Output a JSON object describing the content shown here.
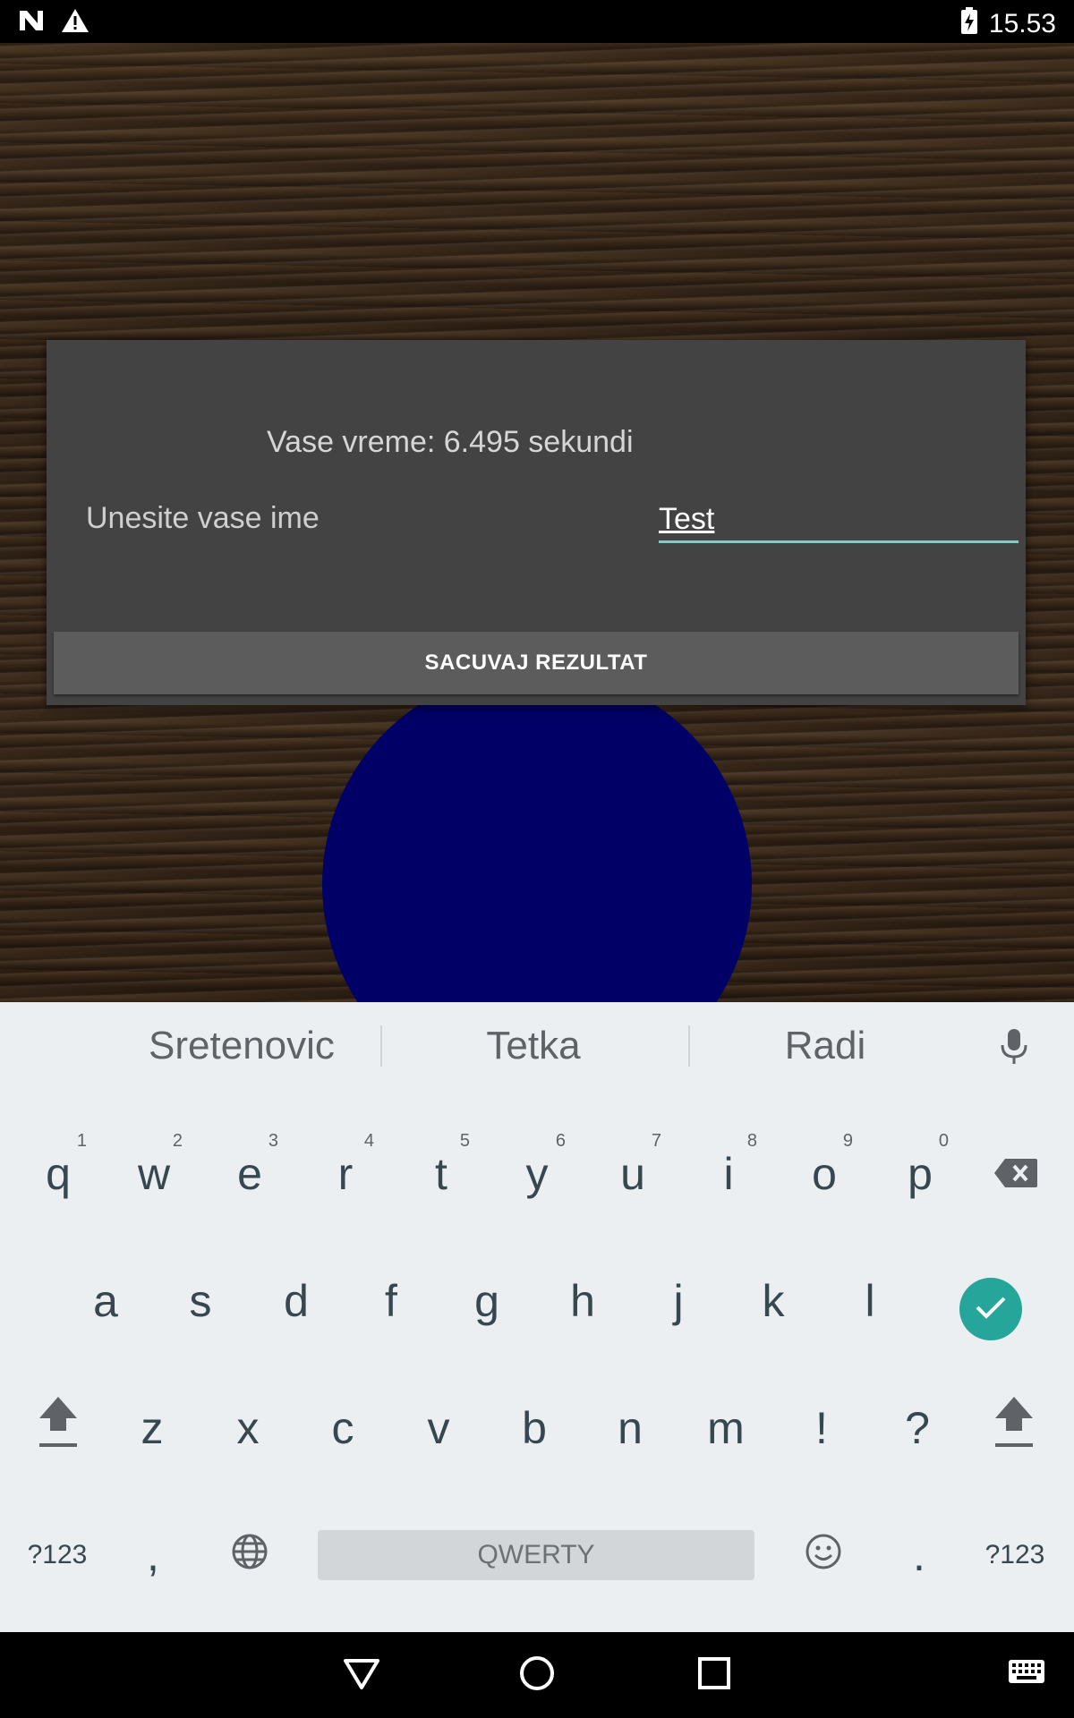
{
  "status_bar": {
    "time": "15.53",
    "icons": [
      "n-icon",
      "warning-icon",
      "battery-charging-icon"
    ]
  },
  "dialog": {
    "time_text": "Vase vreme: 6.495 sekundi",
    "name_label": "Unesite vase ime",
    "name_value": "Test",
    "save_label": "SACUVAJ REZULTAT"
  },
  "keyboard": {
    "suggestions": [
      "Sretenovic",
      "Tetka",
      "Radi"
    ],
    "row1": [
      {
        "k": "q",
        "h": "1"
      },
      {
        "k": "w",
        "h": "2"
      },
      {
        "k": "e",
        "h": "3"
      },
      {
        "k": "r",
        "h": "4"
      },
      {
        "k": "t",
        "h": "5"
      },
      {
        "k": "y",
        "h": "6"
      },
      {
        "k": "u",
        "h": "7"
      },
      {
        "k": "i",
        "h": "8"
      },
      {
        "k": "o",
        "h": "9"
      },
      {
        "k": "p",
        "h": "0"
      }
    ],
    "row2": [
      "a",
      "s",
      "d",
      "f",
      "g",
      "h",
      "j",
      "k",
      "l"
    ],
    "row3": [
      "z",
      "x",
      "c",
      "v",
      "b",
      "n",
      "m",
      "!",
      "?"
    ],
    "symbols_label": "?123",
    "comma": ",",
    "period": ".",
    "space_label": "QWERTY"
  },
  "colors": {
    "circle": "#000066",
    "accent": "#26a69a",
    "dialog_bg": "#434343"
  }
}
